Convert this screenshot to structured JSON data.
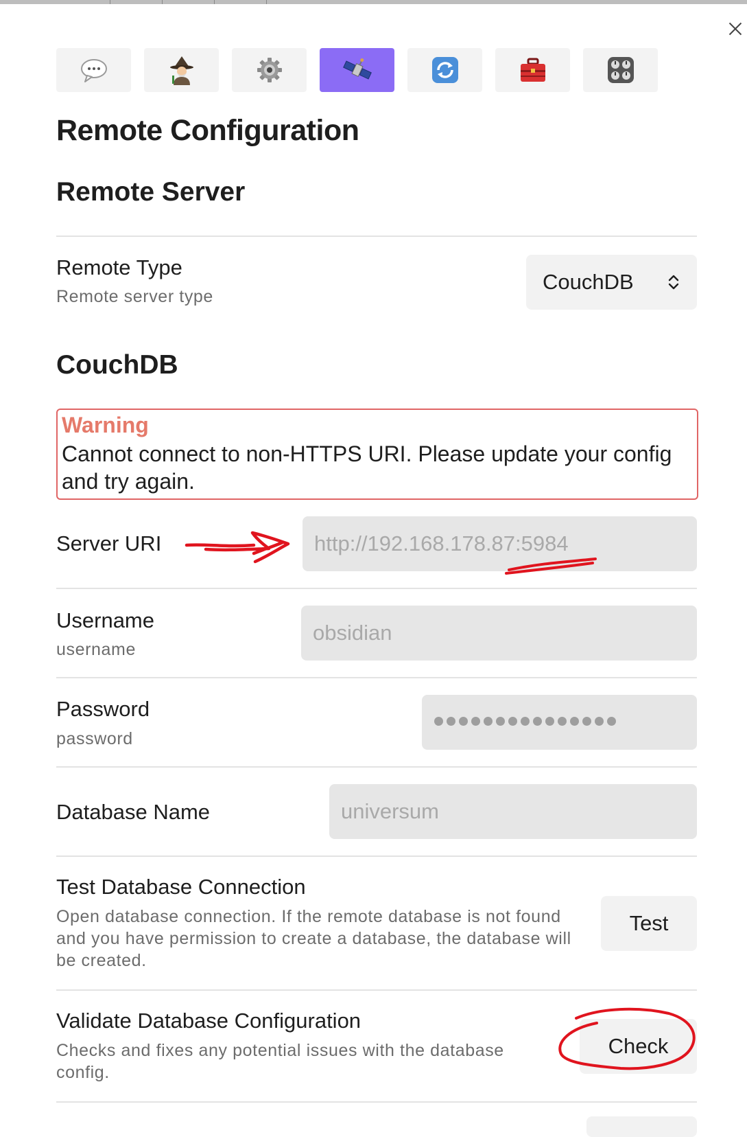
{
  "tabs": [
    {
      "name": "speech-balloon-icon"
    },
    {
      "name": "mage-icon"
    },
    {
      "name": "gear-icon"
    },
    {
      "name": "satellite-icon",
      "active": true
    },
    {
      "name": "sync-arrows-icon"
    },
    {
      "name": "toolbox-icon"
    },
    {
      "name": "control-knobs-icon"
    }
  ],
  "page_title": "Remote Configuration",
  "remote_server": {
    "heading": "Remote Server",
    "remote_type": {
      "label": "Remote Type",
      "description": "Remote server type",
      "selected": "CouchDB"
    }
  },
  "couchdb": {
    "heading": "CouchDB",
    "warning": {
      "title": "Warning",
      "message": "Cannot connect to non-HTTPS URI. Please update your config and try again."
    },
    "server_uri": {
      "label": "Server URI",
      "value": "http://192.168.178.87:5984"
    },
    "username": {
      "label": "Username",
      "description": "username",
      "value": "obsidian"
    },
    "password": {
      "label": "Password",
      "description": "password",
      "masked_length": 15
    },
    "database_name": {
      "label": "Database Name",
      "value": "universum"
    },
    "test_connection": {
      "label": "Test Database Connection",
      "description": "Open database connection. If the remote database is not found and you have permission to create a database, the database will be created.",
      "button": "Test"
    },
    "validate": {
      "label": "Validate Database Configuration",
      "description": "Checks and fixes any potential issues with the database config.",
      "button": "Check"
    }
  },
  "colors": {
    "active_tab": "#8b6cf5",
    "warning_border": "#e06565",
    "warning_title": "#e57a6a",
    "annotation_red": "#e0141e"
  }
}
